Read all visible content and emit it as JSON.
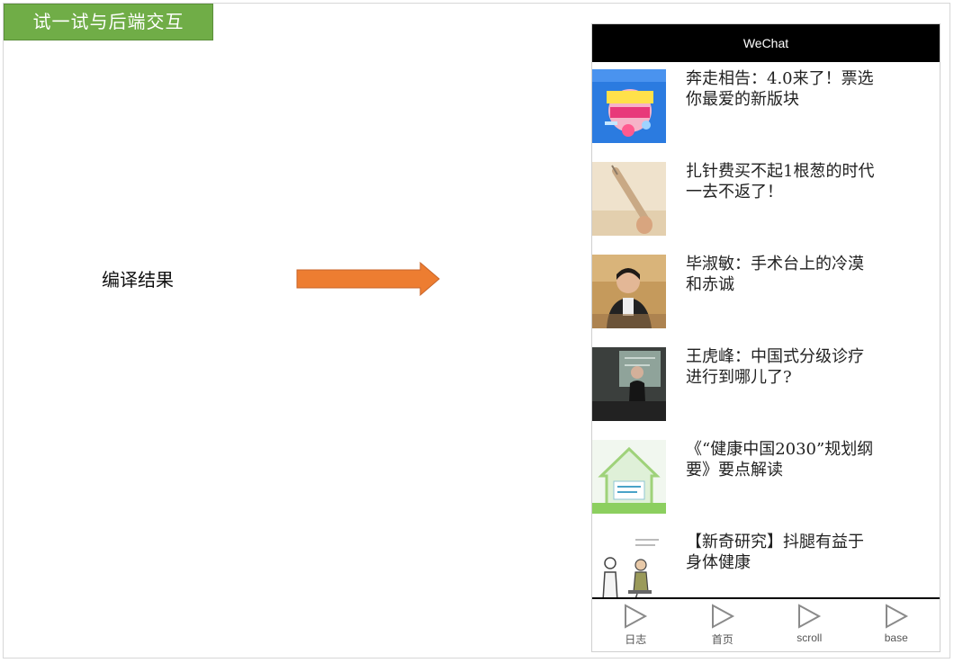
{
  "slide": {
    "title": "试一试与后端交互",
    "result_label": "编译结果",
    "colors": {
      "title_bg": "#70ad47",
      "arrow": "#ed7d31"
    }
  },
  "phone": {
    "header_title": "WeChat",
    "news": [
      {
        "title": "奔走相告：4.0来了！票选你最爱的新版块",
        "thumb": "banner-thumbnail"
      },
      {
        "title": "扎针费买不起1根葱的时代一去不返了！",
        "thumb": "syringe-thumbnail"
      },
      {
        "title": "毕淑敏：手术台上的冷漠和赤诚",
        "thumb": "portrait-thumbnail"
      },
      {
        "title": "王虎峰：中国式分级诊疗进行到哪儿了?",
        "thumb": "speaker-thumbnail"
      },
      {
        "title": "《“健康中国2030”规划纲要》要点解读",
        "thumb": "house-thumbnail"
      },
      {
        "title": "【新奇研究】抖腿有益于身体健康",
        "thumb": "cartoon-thumbnail"
      }
    ],
    "tabs": [
      {
        "label": "日志",
        "icon": "play-triangle-icon"
      },
      {
        "label": "首页",
        "icon": "play-triangle-icon"
      },
      {
        "label": "scroll",
        "icon": "play-triangle-icon"
      },
      {
        "label": "base",
        "icon": "play-triangle-icon"
      }
    ]
  }
}
